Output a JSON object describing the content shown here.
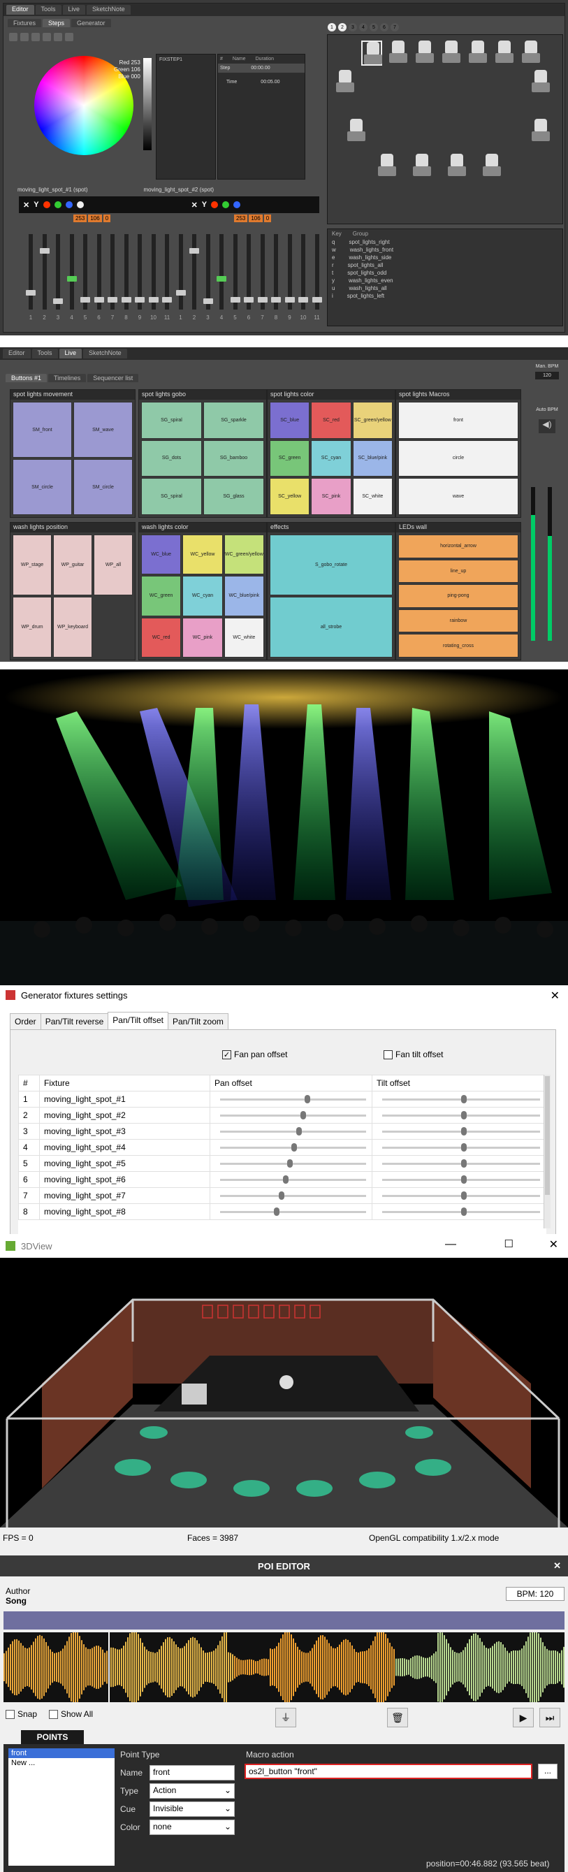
{
  "editor": {
    "tabs": [
      "Editor",
      "Tools",
      "Live",
      "SketchNote"
    ],
    "subtabs": [
      "Fixtures",
      "Steps",
      "Generator"
    ],
    "rgb": {
      "red": "Red 253",
      "green": "Green 106",
      "blue": "Blue 000"
    },
    "step_item": "FIXSTEP1",
    "step_cols": [
      "#",
      "Name",
      "Duration"
    ],
    "step_row": {
      "name": "Step",
      "dur": "00:00.00"
    },
    "time_label": "Time",
    "time_val": "00:05.00",
    "bank_labels": [
      "moving_light_spot_#1 (spot)",
      "moving_light_spot_#2 (spot)"
    ],
    "dmx_values": [
      "253",
      "106",
      "0",
      "253",
      "106",
      "0"
    ],
    "slider_numbers": [
      "1",
      "2",
      "3",
      "4",
      "5",
      "6",
      "7",
      "8",
      "9",
      "10",
      "11",
      "1",
      "2",
      "3",
      "4",
      "5",
      "6",
      "7",
      "8",
      "9",
      "10",
      "11"
    ],
    "group_header": {
      "key": "Key",
      "group": "Group"
    },
    "groups": [
      {
        "key": "q",
        "name": "spot_lights_right"
      },
      {
        "key": "w",
        "name": "wash_lights_front"
      },
      {
        "key": "e",
        "name": "wash_lights_side"
      },
      {
        "key": "r",
        "name": "spot_lights_all"
      },
      {
        "key": "t",
        "name": "spot_lights_odd"
      },
      {
        "key": "y",
        "name": "wash_lights_even"
      },
      {
        "key": "u",
        "name": "wash_lights_all"
      },
      {
        "key": "i",
        "name": "spot_lights_left"
      }
    ],
    "page_buttons": [
      "1",
      "2",
      "3",
      "4",
      "5",
      "6",
      "7"
    ]
  },
  "live": {
    "tabs": [
      "Editor",
      "Tools",
      "Live",
      "SketchNote"
    ],
    "subtabs": [
      "Buttons #1",
      "Timelines",
      "Sequencer list"
    ],
    "bpm_label": "Man. BPM",
    "bpm_value": "120",
    "auto_bpm": "Auto BPM",
    "sections": [
      {
        "title": "spot lights movement",
        "buttons": [
          "SM_front",
          "SM_wave",
          "SM_circle",
          "SM_circle"
        ]
      },
      {
        "title": "spot lights gobo",
        "buttons": [
          "SG_spiral",
          "SG_sparkle",
          "SG_dots",
          "SG_bamboo",
          "SG_spiral",
          "SG_glass"
        ]
      },
      {
        "title": "spot lights color",
        "buttons": [
          "SC_blue",
          "SC_red",
          "SC_green/yellow",
          "SC_green",
          "SC_cyan",
          "SC_blue/pink",
          "SC_yellow",
          "SC_pink",
          "SC_white"
        ]
      },
      {
        "title": "spot lights Macros",
        "buttons": [
          "front",
          "circle",
          "wave"
        ]
      },
      {
        "title": "wash lights position",
        "buttons": [
          "WP_stage",
          "WP_guitar",
          "WP_all",
          "WP_drum",
          "WP_keyboard"
        ]
      },
      {
        "title": "wash lights color",
        "buttons": [
          "WC_blue",
          "WC_yellow",
          "WC_green/yellow",
          "WC_green",
          "WC_cyan",
          "WC_blue/pink",
          "WC_red",
          "WC_pink",
          "WC_white"
        ]
      },
      {
        "title": "effects",
        "buttons": [
          "S_gobo_rotate",
          "all_strobe"
        ]
      },
      {
        "title": "LEDs wall",
        "buttons": [
          "horizontal_arrow",
          "line_up",
          "ping-pong",
          "rainbow",
          "rotating_cross"
        ]
      }
    ]
  },
  "dialog": {
    "title": "Generator fixtures settings",
    "tabs": [
      "Order",
      "Pan/Tilt reverse",
      "Pan/Tilt offset",
      "Pan/Tilt zoom"
    ],
    "fan_pan": "Fan pan offset",
    "fan_tilt": "Fan tilt offset",
    "cols": [
      "#",
      "Fixture",
      "Pan offset",
      "Tilt offset"
    ],
    "rows": [
      {
        "n": "1",
        "name": "moving_light_spot_#1",
        "pan": 0.58,
        "tilt": 0.5
      },
      {
        "n": "2",
        "name": "moving_light_spot_#2",
        "pan": 0.55,
        "tilt": 0.5
      },
      {
        "n": "3",
        "name": "moving_light_spot_#3",
        "pan": 0.52,
        "tilt": 0.5
      },
      {
        "n": "4",
        "name": "moving_light_spot_#4",
        "pan": 0.49,
        "tilt": 0.5
      },
      {
        "n": "5",
        "name": "moving_light_spot_#5",
        "pan": 0.46,
        "tilt": 0.5
      },
      {
        "n": "6",
        "name": "moving_light_spot_#6",
        "pan": 0.43,
        "tilt": 0.5
      },
      {
        "n": "7",
        "name": "moving_light_spot_#7",
        "pan": 0.4,
        "tilt": 0.5
      },
      {
        "n": "8",
        "name": "moving_light_spot_#8",
        "pan": 0.37,
        "tilt": 0.5
      }
    ]
  },
  "view3d": {
    "title": "3DView",
    "fps": "FPS = 0",
    "faces": "Faces = 3987",
    "mode": "OpenGL compatibility 1.x/2.x mode"
  },
  "poi": {
    "title": "POI EDITOR",
    "author_label": "Author",
    "song": "Song",
    "bpm": "BPM: 120",
    "snap": "Snap",
    "show_all": "Show All",
    "points_tab": "POINTS",
    "points": [
      "front",
      "New ..."
    ],
    "point_type": "Point Type",
    "name_label": "Name",
    "name_value": "front",
    "type_label": "Type",
    "type_value": "Action",
    "cue_label": "Cue",
    "cue_value": "Invisible",
    "color_label": "Color",
    "color_value": "none",
    "macro_label": "Macro action",
    "macro_value": "os2l_button \"front\"",
    "browse": "...",
    "position": "position=00:46.882 (93.565 beat)"
  }
}
